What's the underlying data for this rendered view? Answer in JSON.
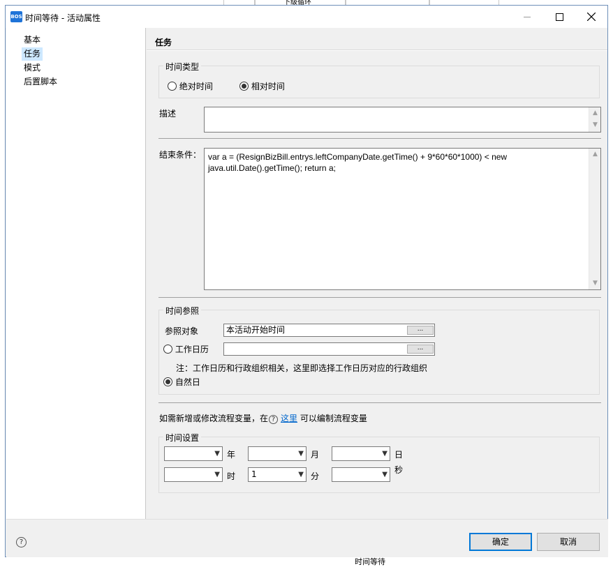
{
  "background": {
    "top_label": "下级循环",
    "bottom_label": "时间等待"
  },
  "window": {
    "app_icon_text": "BOS",
    "title": "时间等待 - 活动属性"
  },
  "nav": {
    "items": [
      {
        "label": "基本",
        "selected": false
      },
      {
        "label": "任务",
        "selected": true
      },
      {
        "label": "模式",
        "selected": false
      },
      {
        "label": "后置脚本",
        "selected": false
      }
    ]
  },
  "section": {
    "title": "任务"
  },
  "time_type": {
    "label": "时间类型",
    "options": [
      "绝对时间",
      "相对时间"
    ],
    "selected": "相对时间"
  },
  "description": {
    "label": "描述",
    "value": ""
  },
  "end_condition": {
    "label": "结束条件：",
    "value": "var a = (ResignBizBill.entrys.leftCompanyDate.getTime() + 9*60*60*1000) < new java.util.Date().getTime(); return a;"
  },
  "time_ref": {
    "label": "时间参照",
    "ref_object_label": "参照对象",
    "ref_object_value": "本活动开始时间",
    "work_calendar_label": "工作日历",
    "work_calendar_value": "",
    "browse_label": "...",
    "note": "注：工作日历和行政组织相关，这里即选择工作日历对应的行政组织",
    "natural_day_label": "自然日",
    "selected": "自然日"
  },
  "variables_hint": {
    "prefix": "如需新增或修改流程变量，在",
    "link": "这里",
    "suffix": "可以编制流程变量"
  },
  "time_settings": {
    "label": "时间设置",
    "year": {
      "label": "年",
      "value": ""
    },
    "month": {
      "label": "月",
      "value": ""
    },
    "day": {
      "label": "日",
      "value": ""
    },
    "hour": {
      "label": "时",
      "value": ""
    },
    "minute": {
      "label": "分",
      "value": "1"
    },
    "second": {
      "label": "秒",
      "value": ""
    }
  },
  "footer": {
    "ok_label": "确定",
    "cancel_label": "取消"
  }
}
